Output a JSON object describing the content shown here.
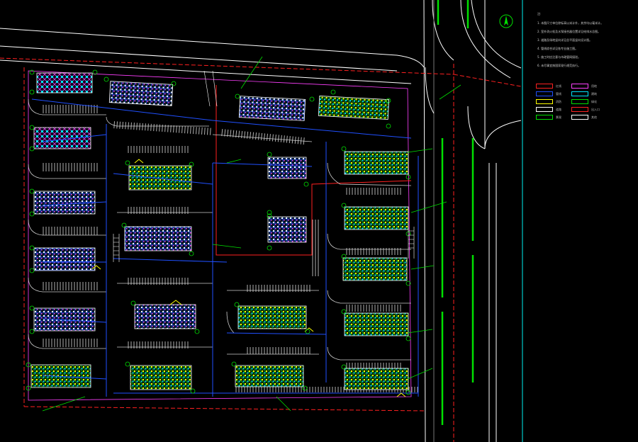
{
  "drawing": {
    "type": "CAD site plan (residential community)",
    "colors": {
      "background": "#000000",
      "road": "#ffffff",
      "redline": "#ff2020",
      "property_line": "#ff40ff",
      "building_outline": "#ffffff",
      "building_fill_a": "#ff40ff",
      "building_fill_b": "#00e5ff",
      "building_fill_c": "#ffff00",
      "pipe": "#2050ff",
      "green": "#00e000",
      "panel_border": "#00c8c8"
    },
    "north_arrow_icon": "north-arrow-icon"
  },
  "notes": {
    "heading": "注:",
    "lines": [
      "1. 本图尺寸单位除标高以米计外，其余均以毫米计。",
      "2. 室外消火栓及水泵接合器位置详见给排水总图。",
      "3. 道路及场地竖向详见总平面竖向设计图。",
      "4. 管线综合详见各专业施工图。",
      "5. 施工时应注意与市政管网接驳。",
      "6. 未尽事宜按国家现行规范执行。"
    ]
  },
  "legend": [
    {
      "swatch": "#ff2020",
      "label": "红线"
    },
    {
      "swatch": "#ff40ff",
      "label": "用地"
    },
    {
      "swatch": "#2050ff",
      "label": "管线"
    },
    {
      "swatch": "#00e5ff",
      "label": "建筑"
    },
    {
      "swatch": "#ffff00",
      "label": "消防"
    },
    {
      "swatch": "#00e000",
      "label": "绿化"
    },
    {
      "swatch": "#ffffff",
      "label": "道路"
    },
    {
      "swatch": "#ff2020",
      "label": "出入口"
    },
    {
      "swatch": "#00e000",
      "label": "景观"
    },
    {
      "swatch": "#ffffff",
      "label": "其他"
    }
  ]
}
